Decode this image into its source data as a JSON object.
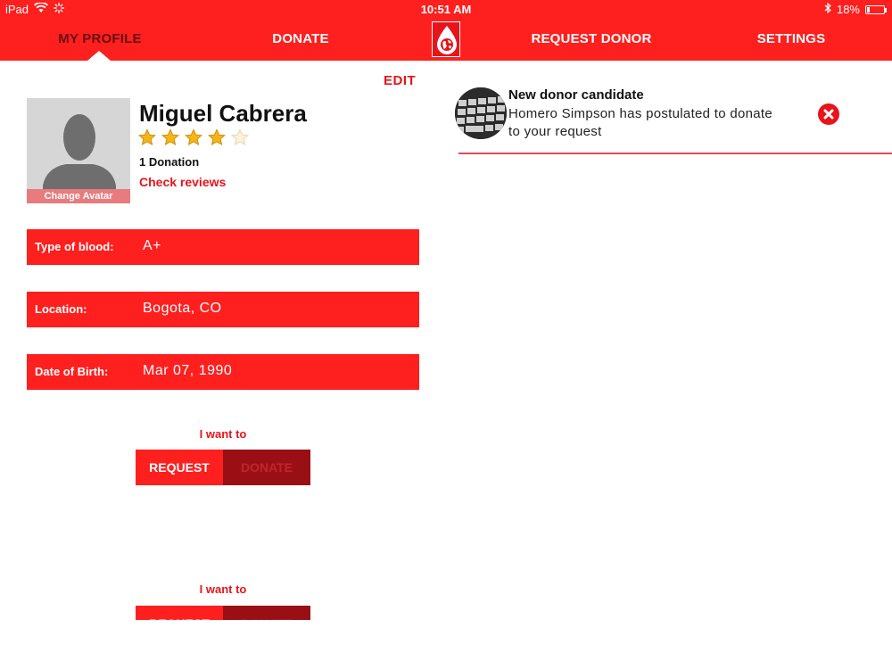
{
  "status_bar": {
    "device": "iPad",
    "time": "10:51 AM",
    "battery": "18%",
    "battery_level": 0.18
  },
  "nav": {
    "tabs": [
      "MY PROFILE",
      "DONATE",
      "REQUEST DONOR",
      "SETTINGS"
    ],
    "active": "MY PROFILE"
  },
  "colors": {
    "primary_red": "#fe1f1f",
    "dark_red": "#9a0f14",
    "active_tab_text": "#6a0d0d"
  },
  "profile": {
    "edit_label": "EDIT",
    "change_avatar": "Change Avatar",
    "name": "Miguel Cabrera",
    "rating": 4,
    "rating_max": 5,
    "donations": "1 Donation",
    "check_reviews": "Check reviews",
    "fields": [
      {
        "label": "Type of blood:",
        "value": "A+"
      },
      {
        "label": "Location:",
        "value": "Bogota, CO"
      },
      {
        "label": "Date of Birth:",
        "value": "Mar 07, 1990"
      }
    ],
    "i_want_to": "I want to",
    "toggle": {
      "request": "REQUEST",
      "donate": "DONATE",
      "selected": "REQUEST"
    }
  },
  "notification": {
    "title": "New donor candidate",
    "body": "Homero Simpson has postulated to donate to your request"
  },
  "icons": {
    "wifi": "wifi-icon",
    "activity": "activity-icon",
    "bluetooth": "bluetooth-icon",
    "battery": "battery-icon",
    "logo": "blood-drop-globe-icon",
    "avatar": "person-silhouette-icon",
    "star": "star-icon",
    "close": "close-icon"
  }
}
